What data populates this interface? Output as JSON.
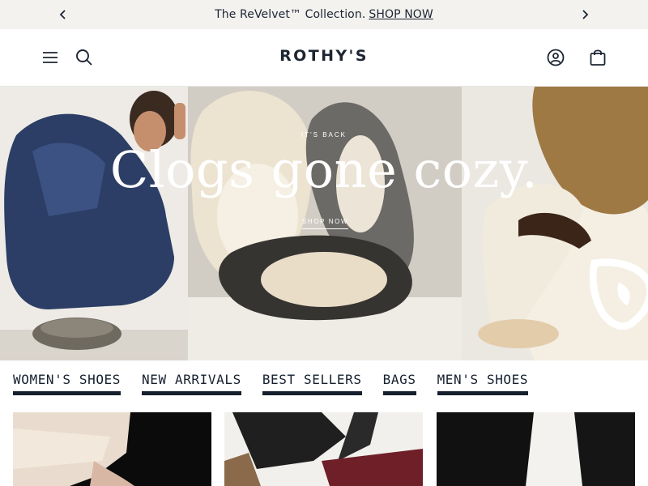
{
  "announcement": {
    "text": "The ReVelvet™ Collection.",
    "link": "SHOP NOW",
    "prev_icon": "chevron-left-icon",
    "next_icon": "chevron-right-icon"
  },
  "header": {
    "logo": "ROTHY'S",
    "menu_icon": "hamburger-menu-icon",
    "search_icon": "search-icon",
    "account_icon": "account-icon",
    "cart_icon": "shopping-bag-icon"
  },
  "hero": {
    "kicker": "IT'S BACK",
    "headline": "Clogs gone cozy.",
    "cta": "SHOP NOW"
  },
  "categories": [
    "WOMEN'S SHOES",
    "NEW ARRIVALS",
    "BEST SELLERS",
    "BAGS",
    "MEN'S SHOES"
  ],
  "colors": {
    "navy": "#16202e",
    "announcement_bg": "#f3f2ef",
    "white": "#ffffff"
  }
}
